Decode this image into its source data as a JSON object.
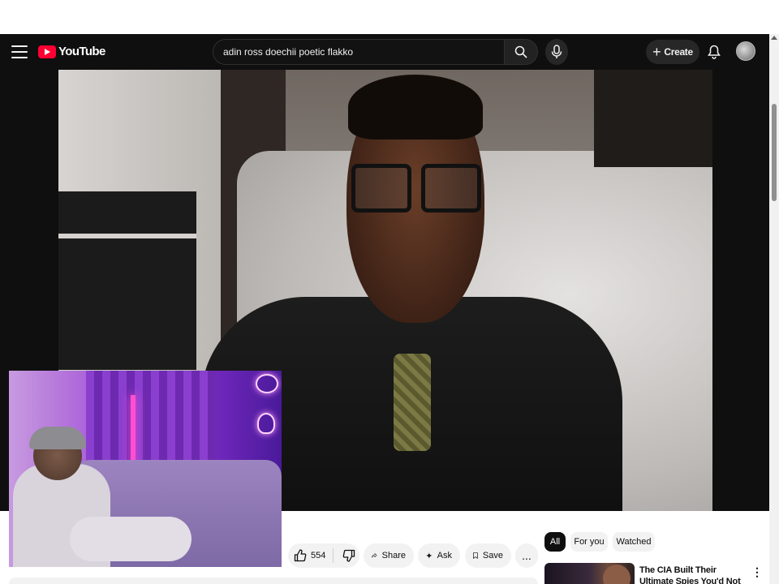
{
  "header": {
    "logo_text": "YouTube",
    "search_value": "adin ross doechii poetic flakko",
    "create_label": "Create",
    "icons": [
      "menu-icon",
      "search-icon",
      "mic-icon",
      "plus-icon",
      "bell-icon"
    ]
  },
  "actions": {
    "like_count": "554",
    "share_label": "Share",
    "ask_label": "Ask",
    "save_label": "Save",
    "more_label": "..."
  },
  "chips": [
    {
      "label": "All",
      "selected": true
    },
    {
      "label": "For you",
      "selected": false
    },
    {
      "label": "Watched",
      "selected": false
    }
  ],
  "recommendation": {
    "title": "The CIA Built Their Ultimate Spies You'd Not Expect"
  },
  "colors": {
    "accent": "#ff0033",
    "header_bg": "#0f0f0f",
    "chip_selected": "#0f0f0f"
  }
}
